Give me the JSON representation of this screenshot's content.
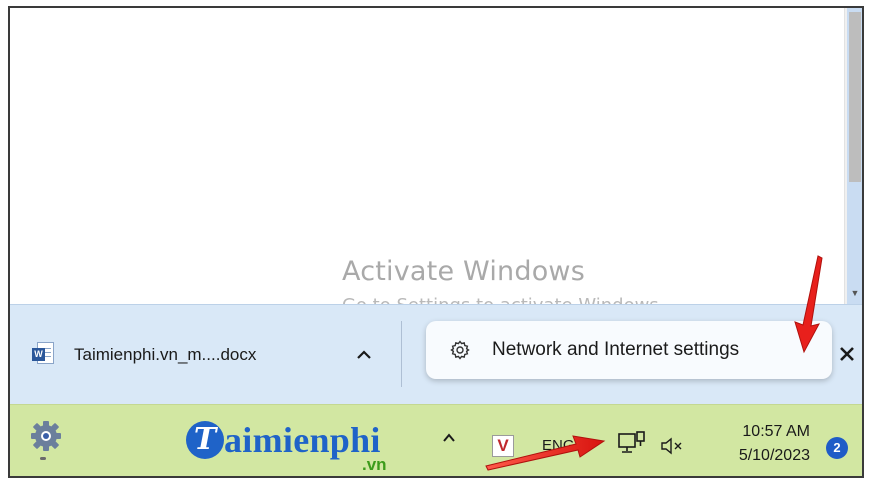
{
  "watermark": {
    "title": "Activate Windows",
    "subtitle": "Go to Settings to activate Windows."
  },
  "download_bar": {
    "file_name": "Taimienphi.vn_m....docx",
    "file_icon": "word-document-icon",
    "expand_icon": "chevron-up-icon",
    "popup_icon": "gear-icon",
    "popup_label": "Network and Internet settings",
    "close_icon": "close-icon"
  },
  "taskbar": {
    "settings_icon": "settings-gear-icon",
    "logo_letter": "T",
    "logo_text": "aimienphi",
    "logo_domain": ".vn",
    "tray_chevron": "^",
    "v_icon_letter": "V",
    "language": "ENG",
    "network_icon": "wired-network-icon",
    "volume_icon": "volume-muted-icon",
    "time": "10:57 AM",
    "date": "5/10/2023",
    "notification_count": "2"
  },
  "colors": {
    "download_bar_bg": "#d9e8f7",
    "taskbar_bg": "#d2e7a2",
    "arrow_red": "#e8201c",
    "logo_blue": "#1f63c8",
    "badge_blue": "#1f5cc7"
  }
}
